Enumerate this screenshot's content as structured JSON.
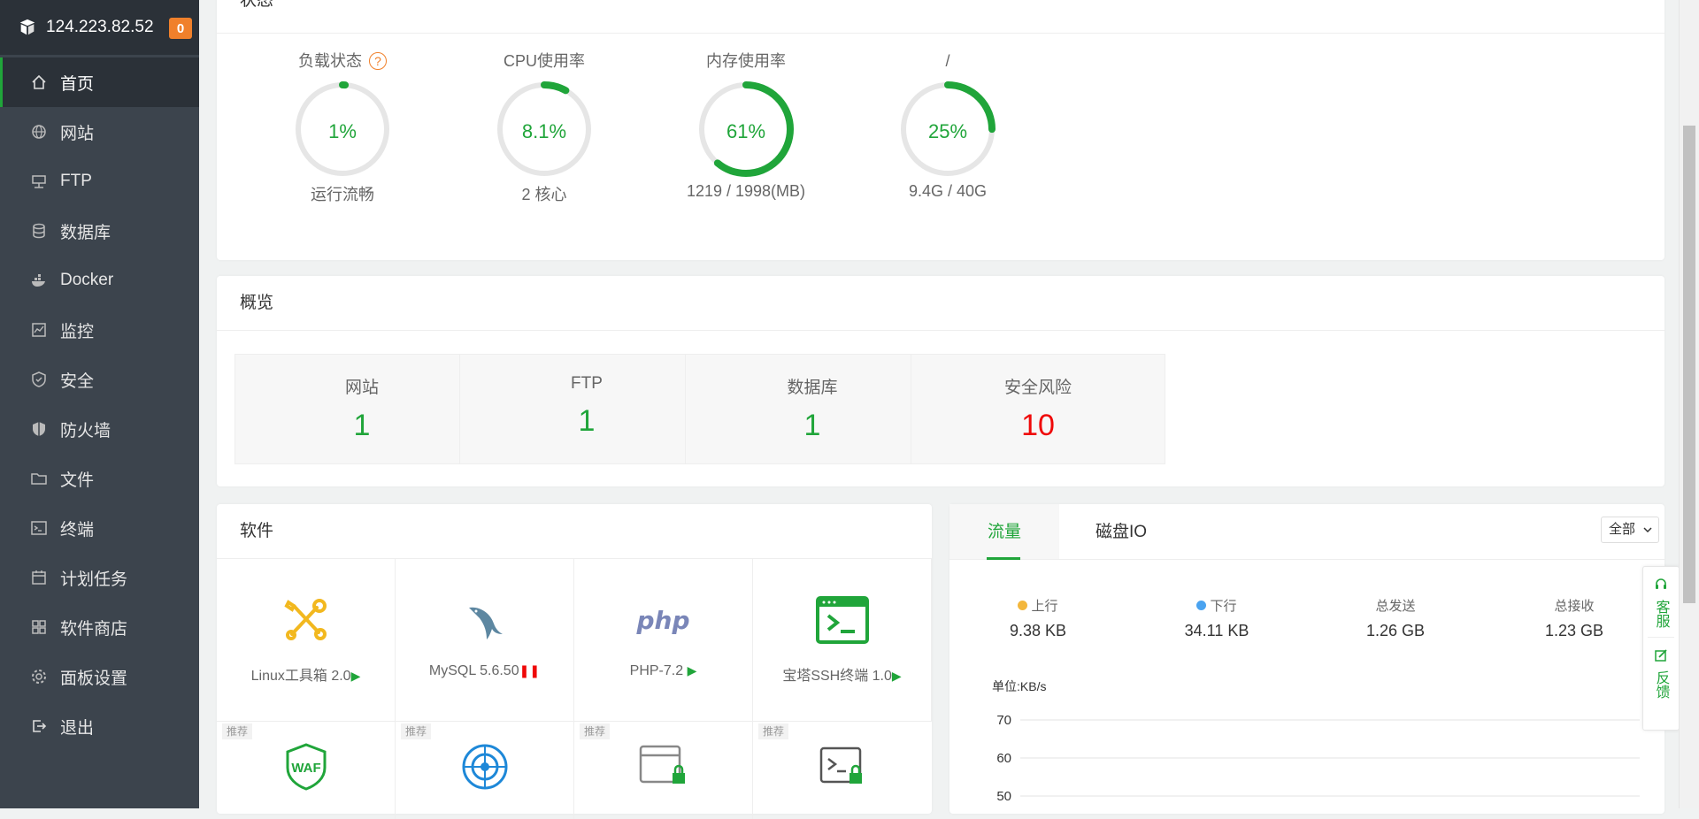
{
  "sidebar": {
    "ip": "124.223.82.52",
    "badge": "0",
    "items": [
      {
        "label": "首页",
        "icon": "home-icon"
      },
      {
        "label": "网站",
        "icon": "globe-icon"
      },
      {
        "label": "FTP",
        "icon": "ftp-icon"
      },
      {
        "label": "数据库",
        "icon": "database-icon"
      },
      {
        "label": "Docker",
        "icon": "docker-icon"
      },
      {
        "label": "监控",
        "icon": "monitor-icon"
      },
      {
        "label": "安全",
        "icon": "shield-icon"
      },
      {
        "label": "防火墙",
        "icon": "firewall-icon"
      },
      {
        "label": "文件",
        "icon": "folder-icon"
      },
      {
        "label": "终端",
        "icon": "terminal-icon"
      },
      {
        "label": "计划任务",
        "icon": "calendar-icon"
      },
      {
        "label": "软件商店",
        "icon": "apps-icon"
      },
      {
        "label": "面板设置",
        "icon": "gear-icon"
      },
      {
        "label": "退出",
        "icon": "logout-icon"
      }
    ]
  },
  "status": {
    "title": "状态",
    "gauges": [
      {
        "label": "负载状态",
        "value": "1%",
        "percent": 1,
        "sub": "运行流畅"
      },
      {
        "label": "CPU使用率",
        "value": "8.1%",
        "percent": 8.1,
        "sub": "2 核心"
      },
      {
        "label": "内存使用率",
        "value": "61%",
        "percent": 61,
        "sub": "1219 / 1998(MB)"
      },
      {
        "label": "/",
        "value": "25%",
        "percent": 25,
        "sub": "9.4G / 40G"
      }
    ],
    "help": "?"
  },
  "overview": {
    "title": "概览",
    "cards": [
      {
        "label": "网站",
        "value": "1"
      },
      {
        "label": "FTP",
        "value": "1"
      },
      {
        "label": "数据库",
        "value": "1"
      },
      {
        "label": "安全风险",
        "value": "10"
      }
    ]
  },
  "software": {
    "title": "软件",
    "items": [
      {
        "name": "Linux工具箱 2.0",
        "state": "▶"
      },
      {
        "name": "MySQL 5.6.50",
        "state": "❚❚"
      },
      {
        "name": "PHP-7.2",
        "state": "▶"
      },
      {
        "name": "宝塔SSH终端 1.0",
        "state": "▶"
      }
    ],
    "recommend_tag": "推荐",
    "php_logo_text": "php",
    "waf_logo_text": "WAF"
  },
  "traffic": {
    "tabs": [
      "流量",
      "磁盘IO"
    ],
    "select_value": "全部",
    "stats": [
      {
        "label": "上行",
        "value": "9.38 KB",
        "dot": "#f3b73d"
      },
      {
        "label": "下行",
        "value": "34.11 KB",
        "dot": "#4aa3f0"
      },
      {
        "label": "总发送",
        "value": "1.26 GB"
      },
      {
        "label": "总接收",
        "value": "1.23 GB"
      }
    ],
    "unit": "单位:KB/s",
    "y_ticks": [
      "70",
      "60",
      "50"
    ]
  },
  "float": {
    "service": "客服",
    "feedback": "反馈"
  },
  "colors": {
    "accent": "#20a53a",
    "danger": "#ef0808",
    "sidebar": "#3c444d",
    "sidebar_header": "#2b3138",
    "badge": "#f0802b"
  }
}
